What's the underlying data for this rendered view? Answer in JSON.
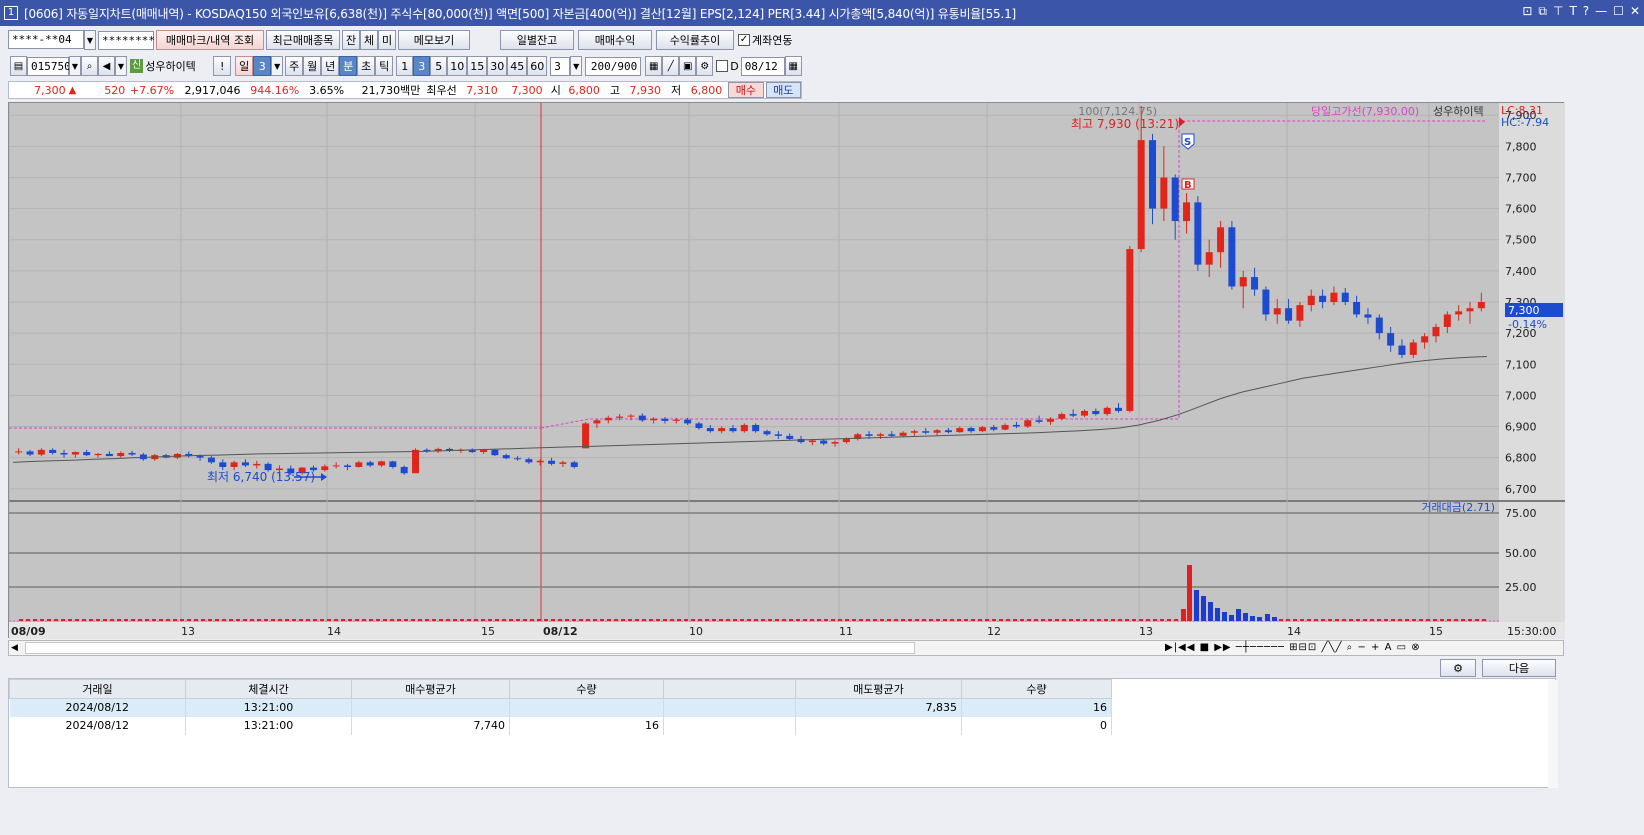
{
  "window": {
    "title": "[0606] 자동일지차트(매매내역) - KOSDAQ150 외국인보유[6,638(천)] 주식수[80,000(천)] 액면[500] 자본금[400(억)] 결산[12월] EPS[2,124] PER[3.44] 시가총액[5,840(억)] 유통비율[55.1]",
    "app_icon": "1",
    "tool_icons": [
      "layout-icon",
      "copy-icon",
      "pin-icon",
      "text-T-icon",
      "help-icon",
      "minimize-icon",
      "maximize-icon",
      "close-icon"
    ],
    "tool_glyphs": [
      "⊡",
      "⧉",
      "⊤",
      "T",
      "?",
      "—",
      "☐",
      "✕"
    ]
  },
  "toolbar1": {
    "account": "****-**04",
    "password": "********",
    "btn_trade_mark": "매매마크/내역 조회",
    "btn_recent": "최근매매종목",
    "btn_jan": "잔",
    "btn_che": "체",
    "btn_mi": "미",
    "btn_memo": "메모보기",
    "btn_daily": "일별잔고",
    "btn_profit": "매매수익",
    "btn_trend": "수익률추이",
    "link_label": "계좌연동",
    "link_checked": true
  },
  "toolbar2": {
    "code": "015750",
    "stock_badge": "신",
    "stock_name": "성우하이텍",
    "exclaim": "!",
    "period_day": "일",
    "period_day_n": "3",
    "week": "주",
    "month": "월",
    "year": "년",
    "minute": "분",
    "second": "초",
    "tick": "틱",
    "intervals": [
      "1",
      "3",
      "5",
      "10",
      "15",
      "30",
      "45",
      "60"
    ],
    "interval_sel": "3",
    "count": "3",
    "range": "200/900",
    "d_label": "D",
    "date": "08/12"
  },
  "quote": {
    "price": "7,300",
    "arrow": "▲",
    "change": "520",
    "pct": "+7.67%",
    "volume": "2,917,046",
    "vol_ratio": "944.16%",
    "turnover": "3.65%",
    "amount": "21,730백만",
    "best_label": "최우선",
    "ask": "7,310",
    "bid": "7,300",
    "open_label": "시",
    "open": "6,800",
    "high_label": "고",
    "high": "7,930",
    "low_label": "저",
    "low": "6,800",
    "buy": "매수",
    "sell": "매도"
  },
  "chart_data": {
    "type": "candlestick",
    "price_axis": {
      "ticks": [
        "7,900",
        "7,800",
        "7,700",
        "7,600",
        "7,500",
        "7,400",
        "7,300",
        "7,200",
        "7,100",
        "7,000",
        "6,900",
        "6,800",
        "6,700"
      ],
      "min": 6700,
      "max": 7900
    },
    "volume_axis": {
      "ticks": [
        "75.00",
        "50.00",
        "25.00"
      ]
    },
    "x_labels": [
      "08/09",
      "13",
      "14",
      "15",
      "08/12",
      "10",
      "11",
      "12",
      "13",
      "14",
      "15",
      "15:30:00"
    ],
    "time_label": "15:30:00",
    "legend_ma": "100(7,124.75)",
    "legend_prevhigh": "당일고가선(7,930.00)",
    "legend_stock": "성우하이텍",
    "lc": "LC:8.31",
    "hc": "HC:-7.94",
    "current_price_tag": "7,300",
    "current_pct_tag": "-0.14%",
    "high_annotation": "최고 7,930 (13:21)",
    "low_annotation": "최저 6,740 (13:57)",
    "volume_legend": "거래대금(2.71)",
    "marker_sell": "S",
    "marker_buy": "B",
    "candles": [
      [
        6820,
        6830,
        6810,
        6820
      ],
      [
        6820,
        6825,
        6805,
        6810
      ],
      [
        6810,
        6830,
        6805,
        6825
      ],
      [
        6825,
        6830,
        6810,
        6815
      ],
      [
        6815,
        6825,
        6800,
        6810
      ],
      [
        6810,
        6820,
        6800,
        6818
      ],
      [
        6818,
        6825,
        6805,
        6808
      ],
      [
        6808,
        6815,
        6800,
        6812
      ],
      [
        6812,
        6820,
        6805,
        6805
      ],
      [
        6805,
        6820,
        6800,
        6815
      ],
      [
        6815,
        6822,
        6805,
        6810
      ],
      [
        6810,
        6815,
        6790,
        6795
      ],
      [
        6795,
        6812,
        6790,
        6808
      ],
      [
        6808,
        6812,
        6798,
        6800
      ],
      [
        6800,
        6815,
        6795,
        6812
      ],
      [
        6812,
        6820,
        6800,
        6805
      ],
      [
        6805,
        6810,
        6790,
        6800
      ],
      [
        6800,
        6805,
        6780,
        6785
      ],
      [
        6785,
        6795,
        6760,
        6770
      ],
      [
        6770,
        6790,
        6760,
        6785
      ],
      [
        6785,
        6795,
        6770,
        6775
      ],
      [
        6775,
        6790,
        6765,
        6780
      ],
      [
        6780,
        6785,
        6755,
        6760
      ],
      [
        6760,
        6775,
        6740,
        6765
      ],
      [
        6765,
        6775,
        6745,
        6750
      ],
      [
        6750,
        6770,
        6745,
        6768
      ],
      [
        6768,
        6775,
        6755,
        6760
      ],
      [
        6760,
        6778,
        6755,
        6772
      ],
      [
        6772,
        6785,
        6765,
        6775
      ],
      [
        6775,
        6780,
        6760,
        6770
      ],
      [
        6770,
        6790,
        6768,
        6785
      ],
      [
        6785,
        6790,
        6770,
        6775
      ],
      [
        6775,
        6790,
        6770,
        6788
      ],
      [
        6788,
        6790,
        6765,
        6770
      ],
      [
        6770,
        6775,
        6745,
        6750
      ],
      [
        6750,
        6830,
        6750,
        6825
      ],
      [
        6825,
        6830,
        6815,
        6820
      ],
      [
        6820,
        6832,
        6815,
        6828
      ],
      [
        6828,
        6832,
        6818,
        6822
      ],
      [
        6822,
        6830,
        6815,
        6825
      ],
      [
        6825,
        6830,
        6815,
        6818
      ],
      [
        6818,
        6828,
        6812,
        6825
      ],
      [
        6825,
        6828,
        6805,
        6808
      ],
      [
        6808,
        6812,
        6795,
        6798
      ],
      [
        6798,
        6805,
        6790,
        6795
      ],
      [
        6795,
        6800,
        6780,
        6785
      ],
      [
        6785,
        6795,
        6775,
        6790
      ],
      [
        6790,
        6800,
        6775,
        6780
      ],
      [
        6780,
        6790,
        6770,
        6785
      ],
      [
        6785,
        6790,
        6765,
        6770
      ],
      [
        6830,
        6915,
        6830,
        6910
      ],
      [
        6910,
        6925,
        6895,
        6920
      ],
      [
        6920,
        6935,
        6910,
        6928
      ],
      [
        6928,
        6940,
        6920,
        6932
      ],
      [
        6932,
        6940,
        6920,
        6935
      ],
      [
        6935,
        6942,
        6915,
        6920
      ],
      [
        6920,
        6930,
        6910,
        6925
      ],
      [
        6925,
        6930,
        6910,
        6918
      ],
      [
        6918,
        6928,
        6910,
        6922
      ],
      [
        6922,
        6928,
        6905,
        6910
      ],
      [
        6910,
        6915,
        6890,
        6895
      ],
      [
        6895,
        6905,
        6880,
        6885
      ],
      [
        6885,
        6900,
        6878,
        6895
      ],
      [
        6895,
        6905,
        6880,
        6885
      ],
      [
        6885,
        6910,
        6880,
        6905
      ],
      [
        6905,
        6910,
        6880,
        6885
      ],
      [
        6885,
        6890,
        6870,
        6875
      ],
      [
        6875,
        6885,
        6860,
        6870
      ],
      [
        6870,
        6878,
        6855,
        6860
      ],
      [
        6860,
        6870,
        6845,
        6850
      ],
      [
        6850,
        6860,
        6840,
        6855
      ],
      [
        6855,
        6860,
        6840,
        6845
      ],
      [
        6845,
        6855,
        6835,
        6850
      ],
      [
        6850,
        6865,
        6845,
        6860
      ],
      [
        6860,
        6880,
        6855,
        6875
      ],
      [
        6875,
        6885,
        6860,
        6870
      ],
      [
        6870,
        6880,
        6860,
        6875
      ],
      [
        6875,
        6885,
        6865,
        6870
      ],
      [
        6870,
        6885,
        6865,
        6880
      ],
      [
        6880,
        6890,
        6870,
        6885
      ],
      [
        6885,
        6895,
        6875,
        6880
      ],
      [
        6880,
        6892,
        6872,
        6888
      ],
      [
        6888,
        6895,
        6878,
        6882
      ],
      [
        6882,
        6900,
        6880,
        6895
      ],
      [
        6895,
        6900,
        6880,
        6885
      ],
      [
        6885,
        6902,
        6882,
        6898
      ],
      [
        6898,
        6905,
        6885,
        6890
      ],
      [
        6890,
        6910,
        6888,
        6905
      ],
      [
        6905,
        6915,
        6895,
        6900
      ],
      [
        6900,
        6925,
        6895,
        6920
      ],
      [
        6920,
        6935,
        6910,
        6915
      ],
      [
        6915,
        6930,
        6905,
        6925
      ],
      [
        6925,
        6945,
        6920,
        6940
      ],
      [
        6940,
        6955,
        6930,
        6935
      ],
      [
        6935,
        6955,
        6930,
        6950
      ],
      [
        6950,
        6958,
        6935,
        6940
      ],
      [
        6940,
        6965,
        6935,
        6960
      ],
      [
        6960,
        6975,
        6945,
        6950
      ],
      [
        6950,
        7480,
        6945,
        7470
      ],
      [
        7470,
        7930,
        7460,
        7820
      ],
      [
        7820,
        7840,
        7550,
        7600
      ],
      [
        7600,
        7800,
        7560,
        7700
      ],
      [
        7700,
        7710,
        7500,
        7560
      ],
      [
        7560,
        7650,
        7520,
        7620
      ],
      [
        7620,
        7640,
        7400,
        7420
      ],
      [
        7420,
        7500,
        7380,
        7460
      ],
      [
        7460,
        7560,
        7410,
        7540
      ],
      [
        7540,
        7560,
        7340,
        7350
      ],
      [
        7350,
        7400,
        7280,
        7380
      ],
      [
        7380,
        7410,
        7320,
        7340
      ],
      [
        7340,
        7350,
        7240,
        7260
      ],
      [
        7260,
        7310,
        7230,
        7280
      ],
      [
        7280,
        7310,
        7230,
        7240
      ],
      [
        7240,
        7300,
        7220,
        7290
      ],
      [
        7290,
        7340,
        7270,
        7320
      ],
      [
        7320,
        7340,
        7280,
        7300
      ],
      [
        7300,
        7350,
        7290,
        7330
      ],
      [
        7330,
        7345,
        7290,
        7300
      ],
      [
        7300,
        7320,
        7250,
        7260
      ],
      [
        7260,
        7280,
        7230,
        7250
      ],
      [
        7250,
        7260,
        7180,
        7200
      ],
      [
        7200,
        7220,
        7140,
        7160
      ],
      [
        7160,
        7180,
        7120,
        7130
      ],
      [
        7130,
        7180,
        7120,
        7170
      ],
      [
        7170,
        7200,
        7150,
        7190
      ],
      [
        7190,
        7230,
        7170,
        7220
      ],
      [
        7220,
        7270,
        7200,
        7260
      ],
      [
        7260,
        7290,
        7240,
        7270
      ],
      [
        7270,
        7300,
        7230,
        7280
      ],
      [
        7280,
        7330,
        7270,
        7300
      ]
    ],
    "ma100": [
      6785,
      6788,
      6790,
      6792,
      6795,
      6797,
      6800,
      6802,
      6805,
      6807,
      6808,
      6810,
      6812,
      6813,
      6814,
      6815,
      6816,
      6817,
      6818,
      6819,
      6820,
      6822,
      6824,
      6826,
      6828,
      6830,
      6832,
      6834,
      6836,
      6838,
      6840,
      6842,
      6844,
      6846,
      6848,
      6850,
      6852,
      6854,
      6856,
      6858,
      6860,
      6862,
      6864,
      6866,
      6868,
      6870,
      6872,
      6874,
      6876,
      6878,
      6880,
      6883,
      6886,
      6890,
      6895,
      6905,
      6920,
      6940,
      6965,
      6990,
      7010,
      7025,
      7040,
      7055,
      7065,
      7075,
      7085,
      7095,
      7105,
      7112,
      7118,
      7122,
      7125
    ]
  },
  "grid": {
    "headers": [
      "거래일",
      "체결시간",
      "매수평균가",
      "수량",
      "",
      "매도평균가",
      "수량"
    ],
    "rows": [
      [
        "2024/08/12",
        "13:21:00",
        "",
        "",
        "",
        "7,835",
        "16"
      ],
      [
        "2024/08/12",
        "13:21:00",
        "7,740",
        "16",
        "",
        "",
        "0"
      ]
    ],
    "next_btn": "다음",
    "settings_icon": "gear-icon"
  },
  "colors": {
    "up": "#e0261b",
    "down": "#1c4bd0",
    "title_bg": "#3b56a8",
    "chart_bg": "#c4c4c4",
    "highline": "#e040c8"
  }
}
